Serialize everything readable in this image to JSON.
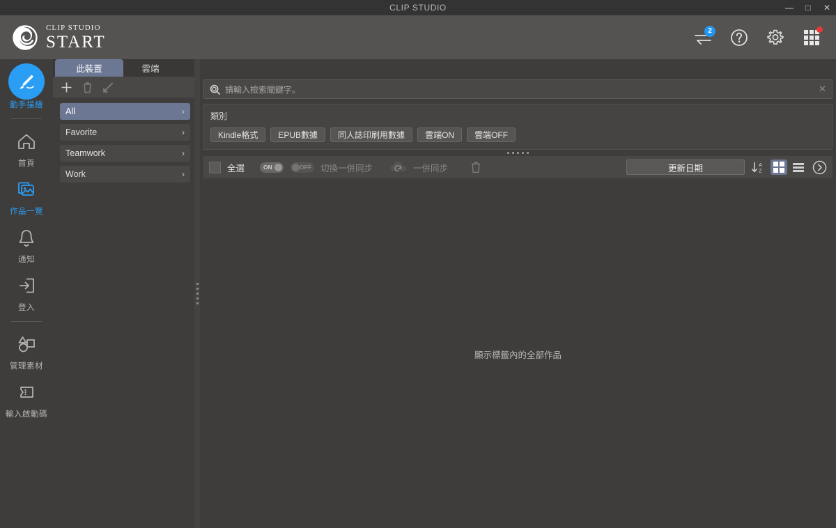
{
  "window": {
    "title": "CLIP STUDIO",
    "controls": [
      {
        "name": "minimize",
        "glyph": "—"
      },
      {
        "name": "maximize",
        "glyph": "□"
      },
      {
        "name": "close",
        "glyph": "✕"
      }
    ]
  },
  "header": {
    "brand_top": "CLIP STUDIO",
    "brand_bottom": "START",
    "icons": [
      {
        "name": "transfer-icon",
        "badge": "2",
        "badge_color": "#2196f3"
      },
      {
        "name": "help-icon",
        "badge": ""
      },
      {
        "name": "gear-icon",
        "badge": ""
      },
      {
        "name": "apps-grid-icon",
        "badge_dot": true,
        "badge_color": "#e53935"
      }
    ]
  },
  "rail": {
    "items": [
      {
        "label": "動手描繪",
        "icon": "brush-icon",
        "state": "highlight"
      },
      {
        "label": "首頁",
        "icon": "home-icon",
        "state": "normal"
      },
      {
        "label": "作品一覽",
        "icon": "gallery-icon",
        "state": "active"
      },
      {
        "label": "通知",
        "icon": "bell-icon",
        "state": "normal"
      },
      {
        "label": "登入",
        "icon": "login-icon",
        "state": "normal"
      },
      {
        "label": "管理素材",
        "icon": "shapes-icon",
        "state": "normal"
      },
      {
        "label": "輸入啟動碼",
        "icon": "serial-key-icon",
        "state": "normal"
      }
    ]
  },
  "panel": {
    "tabs": [
      {
        "label": "此裝置",
        "active": true
      },
      {
        "label": "雲端",
        "active": false
      }
    ],
    "tools": [
      {
        "name": "add-category-button",
        "icon": "plus-icon"
      },
      {
        "name": "delete-category-button",
        "icon": "trash-icon"
      },
      {
        "name": "edit-category-button",
        "icon": "pencil-icon"
      }
    ],
    "categories": [
      {
        "label": "All",
        "selected": true
      },
      {
        "label": "Favorite",
        "selected": false
      },
      {
        "label": "Teamwork",
        "selected": false
      },
      {
        "label": "Work",
        "selected": false
      }
    ],
    "chevron": "›"
  },
  "search": {
    "placeholder": "請輸入檢索關鍵字。",
    "value": "",
    "clear_glyph": "✕"
  },
  "category_filter": {
    "title": "類別",
    "tags": [
      "Kindle格式",
      "EPUB數據",
      "同人誌印刷用數據",
      "雲端ON",
      "雲端OFF"
    ]
  },
  "toolbar": {
    "select_all_label": "全選",
    "toggle_on_label": "ON",
    "toggle_off_label": "OFF",
    "switch_sync_label": "切換一併同步",
    "sync_all_label": "一併同步",
    "delete_icon": "trash-icon",
    "sort_value": "更新日期",
    "sort_direction_icon": "sort-az-descending-icon",
    "view_grid_icon": "grid-view-icon",
    "view_list_icon": "list-view-icon",
    "expand_icon": "chevron-right-circle-icon"
  },
  "content": {
    "empty_message": "顯示標籤內的全部作品"
  },
  "colors": {
    "accent_blue": "#2a9df4",
    "selection": "#6c7893",
    "background": "#3f3d3c",
    "header": "#555352",
    "titlebar": "#333333"
  }
}
